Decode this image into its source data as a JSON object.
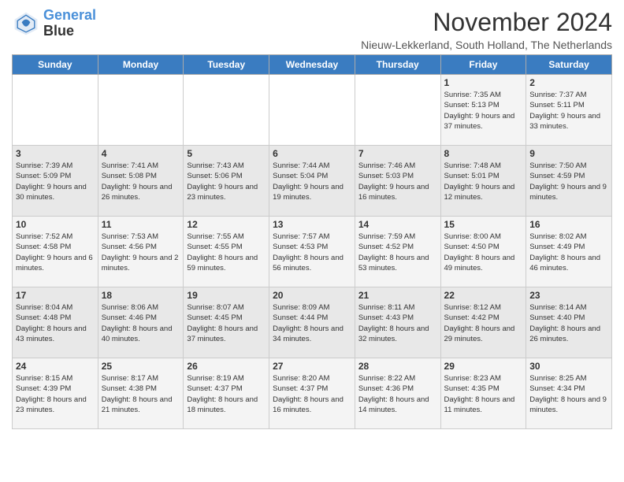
{
  "header": {
    "logo_line1": "General",
    "logo_line2": "Blue",
    "title": "November 2024",
    "subtitle": "Nieuw-Lekkerland, South Holland, The Netherlands"
  },
  "days_of_week": [
    "Sunday",
    "Monday",
    "Tuesday",
    "Wednesday",
    "Thursday",
    "Friday",
    "Saturday"
  ],
  "weeks": [
    [
      {
        "day": "",
        "info": ""
      },
      {
        "day": "",
        "info": ""
      },
      {
        "day": "",
        "info": ""
      },
      {
        "day": "",
        "info": ""
      },
      {
        "day": "",
        "info": ""
      },
      {
        "day": "1",
        "info": "Sunrise: 7:35 AM\nSunset: 5:13 PM\nDaylight: 9 hours and 37 minutes."
      },
      {
        "day": "2",
        "info": "Sunrise: 7:37 AM\nSunset: 5:11 PM\nDaylight: 9 hours and 33 minutes."
      }
    ],
    [
      {
        "day": "3",
        "info": "Sunrise: 7:39 AM\nSunset: 5:09 PM\nDaylight: 9 hours and 30 minutes."
      },
      {
        "day": "4",
        "info": "Sunrise: 7:41 AM\nSunset: 5:08 PM\nDaylight: 9 hours and 26 minutes."
      },
      {
        "day": "5",
        "info": "Sunrise: 7:43 AM\nSunset: 5:06 PM\nDaylight: 9 hours and 23 minutes."
      },
      {
        "day": "6",
        "info": "Sunrise: 7:44 AM\nSunset: 5:04 PM\nDaylight: 9 hours and 19 minutes."
      },
      {
        "day": "7",
        "info": "Sunrise: 7:46 AM\nSunset: 5:03 PM\nDaylight: 9 hours and 16 minutes."
      },
      {
        "day": "8",
        "info": "Sunrise: 7:48 AM\nSunset: 5:01 PM\nDaylight: 9 hours and 12 minutes."
      },
      {
        "day": "9",
        "info": "Sunrise: 7:50 AM\nSunset: 4:59 PM\nDaylight: 9 hours and 9 minutes."
      }
    ],
    [
      {
        "day": "10",
        "info": "Sunrise: 7:52 AM\nSunset: 4:58 PM\nDaylight: 9 hours and 6 minutes."
      },
      {
        "day": "11",
        "info": "Sunrise: 7:53 AM\nSunset: 4:56 PM\nDaylight: 9 hours and 2 minutes."
      },
      {
        "day": "12",
        "info": "Sunrise: 7:55 AM\nSunset: 4:55 PM\nDaylight: 8 hours and 59 minutes."
      },
      {
        "day": "13",
        "info": "Sunrise: 7:57 AM\nSunset: 4:53 PM\nDaylight: 8 hours and 56 minutes."
      },
      {
        "day": "14",
        "info": "Sunrise: 7:59 AM\nSunset: 4:52 PM\nDaylight: 8 hours and 53 minutes."
      },
      {
        "day": "15",
        "info": "Sunrise: 8:00 AM\nSunset: 4:50 PM\nDaylight: 8 hours and 49 minutes."
      },
      {
        "day": "16",
        "info": "Sunrise: 8:02 AM\nSunset: 4:49 PM\nDaylight: 8 hours and 46 minutes."
      }
    ],
    [
      {
        "day": "17",
        "info": "Sunrise: 8:04 AM\nSunset: 4:48 PM\nDaylight: 8 hours and 43 minutes."
      },
      {
        "day": "18",
        "info": "Sunrise: 8:06 AM\nSunset: 4:46 PM\nDaylight: 8 hours and 40 minutes."
      },
      {
        "day": "19",
        "info": "Sunrise: 8:07 AM\nSunset: 4:45 PM\nDaylight: 8 hours and 37 minutes."
      },
      {
        "day": "20",
        "info": "Sunrise: 8:09 AM\nSunset: 4:44 PM\nDaylight: 8 hours and 34 minutes."
      },
      {
        "day": "21",
        "info": "Sunrise: 8:11 AM\nSunset: 4:43 PM\nDaylight: 8 hours and 32 minutes."
      },
      {
        "day": "22",
        "info": "Sunrise: 8:12 AM\nSunset: 4:42 PM\nDaylight: 8 hours and 29 minutes."
      },
      {
        "day": "23",
        "info": "Sunrise: 8:14 AM\nSunset: 4:40 PM\nDaylight: 8 hours and 26 minutes."
      }
    ],
    [
      {
        "day": "24",
        "info": "Sunrise: 8:15 AM\nSunset: 4:39 PM\nDaylight: 8 hours and 23 minutes."
      },
      {
        "day": "25",
        "info": "Sunrise: 8:17 AM\nSunset: 4:38 PM\nDaylight: 8 hours and 21 minutes."
      },
      {
        "day": "26",
        "info": "Sunrise: 8:19 AM\nSunset: 4:37 PM\nDaylight: 8 hours and 18 minutes."
      },
      {
        "day": "27",
        "info": "Sunrise: 8:20 AM\nSunset: 4:37 PM\nDaylight: 8 hours and 16 minutes."
      },
      {
        "day": "28",
        "info": "Sunrise: 8:22 AM\nSunset: 4:36 PM\nDaylight: 8 hours and 14 minutes."
      },
      {
        "day": "29",
        "info": "Sunrise: 8:23 AM\nSunset: 4:35 PM\nDaylight: 8 hours and 11 minutes."
      },
      {
        "day": "30",
        "info": "Sunrise: 8:25 AM\nSunset: 4:34 PM\nDaylight: 8 hours and 9 minutes."
      }
    ]
  ]
}
